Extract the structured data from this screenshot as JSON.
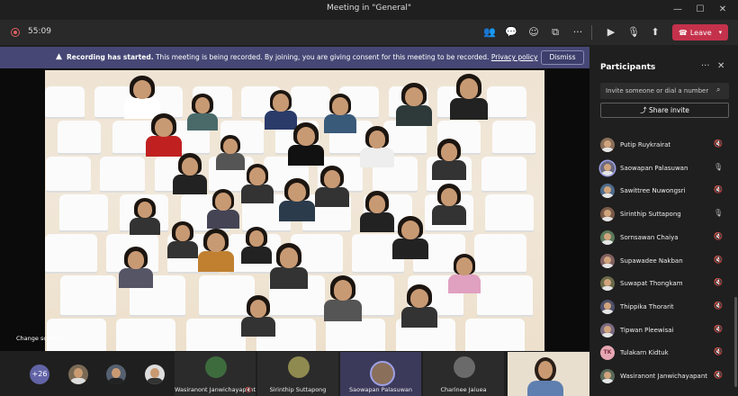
{
  "window": {
    "title": "Meeting in \"General\""
  },
  "toolbar": {
    "timer": "55:09",
    "leave_label": "Leave",
    "icons": [
      "participants-icon",
      "chat-icon",
      "reactions-icon",
      "share-tray-icon",
      "more-icon",
      "camera-icon",
      "mic-icon",
      "share-icon"
    ]
  },
  "banner": {
    "bold": "Recording has started.",
    "text": " This meeting is being recorded. By joining, you are giving consent for this meeting to be recorded. ",
    "link": "Privacy policy",
    "dismiss": "Dismiss"
  },
  "stage": {
    "change_scene": "Change scene"
  },
  "bottom": {
    "more_count": "+26",
    "tiles": [
      {
        "name": "Wasiranont Janwichayapant"
      },
      {
        "name": "Sirinthip Suttapong"
      },
      {
        "name": "Saowapan Palasuwan"
      },
      {
        "name": "Charinee Jaiuea"
      }
    ]
  },
  "panel": {
    "title": "Participants",
    "invite_placeholder": "Invite someone or dial a number",
    "share_invite": "Share invite",
    "participants": [
      {
        "name": "Putip Ruykrairat",
        "mic": "muted"
      },
      {
        "name": "Saowapan Palasuwan",
        "mic": "on"
      },
      {
        "name": "Sawittree Nuwongsri",
        "mic": "muted"
      },
      {
        "name": "Sirinthip Suttapong",
        "mic": "on"
      },
      {
        "name": "Sornsawan Chaiya",
        "mic": "muted"
      },
      {
        "name": "Supawadee Nakban",
        "mic": "muted"
      },
      {
        "name": "Suwapat Thongkam",
        "mic": "muted"
      },
      {
        "name": "Thippika Thorarit",
        "mic": "muted"
      },
      {
        "name": "Tipwan Pleewisai",
        "mic": "muted"
      },
      {
        "name": "Tulakarn Kidtuk",
        "mic": "muted",
        "initials": "TK"
      },
      {
        "name": "Wasiranont Janwichayapant",
        "mic": "muted"
      }
    ]
  },
  "colors": {
    "accent": "#6264a7",
    "leave": "#c4314b",
    "banner": "#464775"
  }
}
